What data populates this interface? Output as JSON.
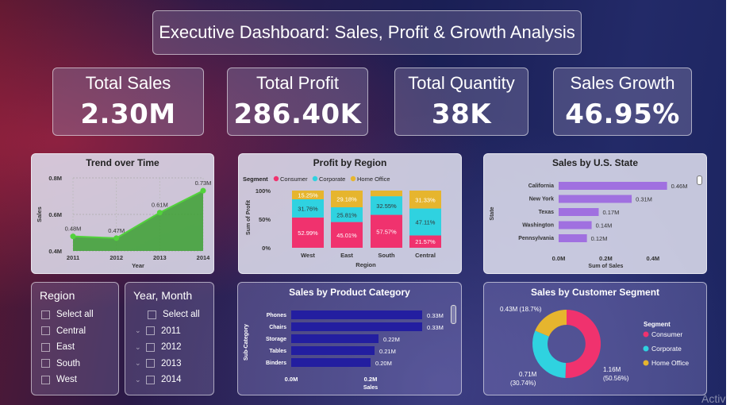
{
  "title": "Executive Dashboard: Sales, Profit & Growth Analysis",
  "kpis": [
    {
      "label": "Total Sales",
      "value": "2.30M"
    },
    {
      "label": "Total Profit",
      "value": "286.40K"
    },
    {
      "label": "Total Quantity",
      "value": "38K"
    },
    {
      "label": "Sales Growth",
      "value": "46.95%"
    }
  ],
  "slicers": {
    "region": {
      "title": "Region",
      "items": [
        "Select all",
        "Central",
        "East",
        "South",
        "West"
      ]
    },
    "year_month": {
      "title": "Year, Month",
      "items": [
        "Select all",
        "2011",
        "2012",
        "2013",
        "2014"
      ]
    }
  },
  "watermark": "Activ",
  "colors": {
    "consumer": "#f0326e",
    "corporate": "#2fd2e0",
    "home_office": "#e6b52e",
    "line": "#52d23c",
    "state_bar": "#a070e0",
    "category_bar": "#231ea0"
  },
  "chart_data": [
    {
      "type": "line",
      "title": "Trend over Time",
      "xlabel": "Year",
      "ylabel": "Sales",
      "x": [
        "2011",
        "2012",
        "2013",
        "2014"
      ],
      "values": [
        0.48,
        0.47,
        0.61,
        0.73
      ],
      "data_labels": [
        "0.48M",
        "0.47M",
        "0.61M",
        "0.73M"
      ],
      "ylim": [
        0.4,
        0.8
      ],
      "yticks": [
        "0.4M",
        "0.6M",
        "0.8M"
      ],
      "yvals": [
        0.4,
        0.6,
        0.8
      ],
      "grid": true
    },
    {
      "type": "bar",
      "stacked": "100%",
      "title": "Profit by Region",
      "xlabel": "Region",
      "ylabel": "Sum of Profit",
      "legend_title": "Segment",
      "legend_position": "top",
      "categories": [
        "West",
        "East",
        "South",
        "Central"
      ],
      "series": [
        {
          "name": "Consumer",
          "values": [
            52.99,
            45.01,
            57.57,
            21.57
          ],
          "labels": [
            "52.99%",
            "45.01%",
            "57.57%",
            "21.57%"
          ]
        },
        {
          "name": "Corporate",
          "values": [
            31.76,
            25.81,
            32.55,
            47.11
          ],
          "labels": [
            "31.76%",
            "25.81%",
            "32.55%",
            "47.11%"
          ]
        },
        {
          "name": "Home Office",
          "values": [
            15.25,
            29.18,
            9.88,
            31.33
          ],
          "labels": [
            "15.25%",
            "29.18%",
            "",
            "31.33%"
          ]
        }
      ],
      "yticks": [
        "0%",
        "50%",
        "100%"
      ],
      "yvals": [
        0,
        50,
        100
      ]
    },
    {
      "type": "bar",
      "orientation": "horizontal",
      "title": "Sales by U.S. State",
      "xlabel": "Sum of Sales",
      "ylabel": "State",
      "categories": [
        "California",
        "New York",
        "Texas",
        "Washington",
        "Pennsylvania"
      ],
      "values": [
        0.46,
        0.31,
        0.17,
        0.14,
        0.12
      ],
      "data_labels": [
        "0.46M",
        "0.31M",
        "0.17M",
        "0.14M",
        "0.12M"
      ],
      "xticks": [
        "0.0M",
        "0.2M",
        "0.4M"
      ],
      "xvals": [
        0,
        0.2,
        0.4
      ],
      "xlim": [
        0,
        0.5
      ]
    },
    {
      "type": "bar",
      "orientation": "horizontal",
      "title": "Sales by Product Category",
      "xlabel": "Sales",
      "ylabel": "Sub-Category",
      "categories": [
        "Phones",
        "Chairs",
        "Storage",
        "Tables",
        "Binders"
      ],
      "values": [
        0.33,
        0.33,
        0.22,
        0.21,
        0.2
      ],
      "data_labels": [
        "0.33M",
        "0.33M",
        "0.22M",
        "0.21M",
        "0.20M"
      ],
      "xticks": [
        "0.0M",
        "0.2M"
      ],
      "xvals": [
        0,
        0.2
      ],
      "xlim": [
        0,
        0.36
      ]
    },
    {
      "type": "pie",
      "donut": true,
      "title": "Sales by Customer Segment",
      "legend_title": "Segment",
      "legend_position": "right",
      "categories": [
        "Consumer",
        "Corporate",
        "Home Office"
      ],
      "values": [
        50.56,
        30.74,
        18.7
      ],
      "data_labels": [
        [
          "1.16M",
          "(50.56%)"
        ],
        [
          "0.71M",
          "(30.74%)"
        ],
        [
          "0.43M (18.7%)"
        ]
      ]
    }
  ]
}
